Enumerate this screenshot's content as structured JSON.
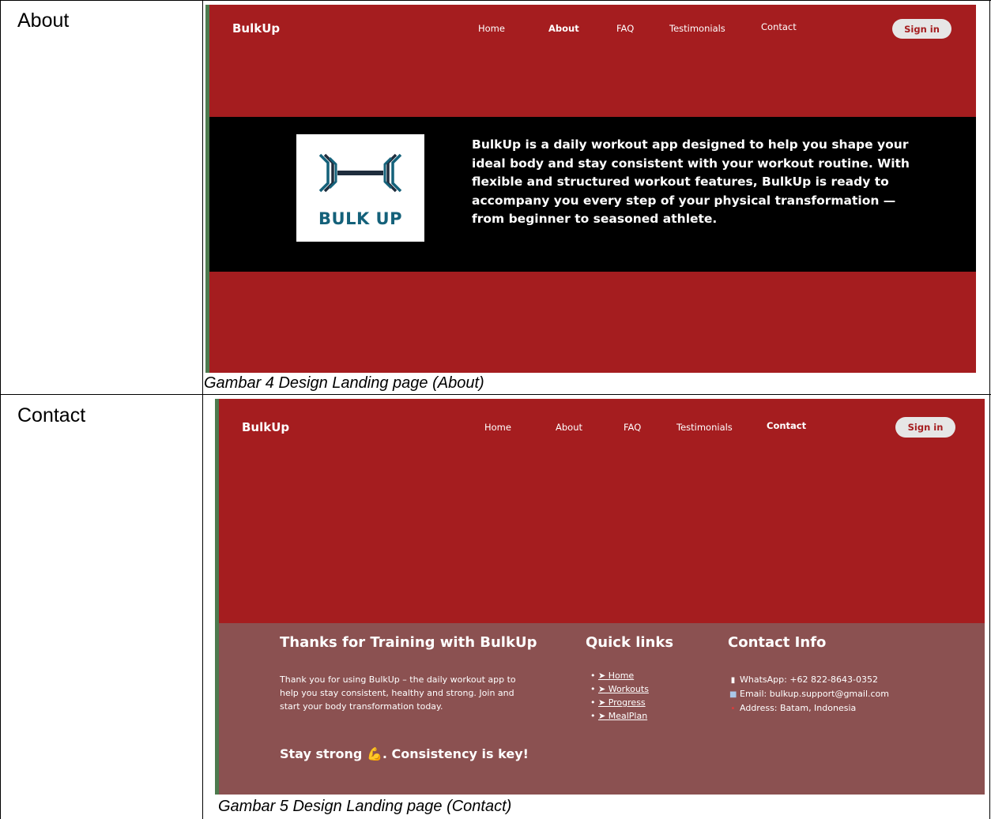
{
  "rows": [
    {
      "label": "About",
      "caption": "Gambar 4 Design Landing page (About)",
      "nav": {
        "brand": "BulkUp",
        "links": [
          "Home",
          "About",
          "FAQ",
          "Testimonials",
          "Contact"
        ],
        "active": "About",
        "signin": "Sign in"
      },
      "logo_text": "BULK UP",
      "about_text": "BulkUp is a daily workout app designed to help you shape your ideal body and stay consistent with your workout routine. With flexible and structured workout features, BulkUp is ready to accompany you every step of your physical transformation — from beginner to seasoned athlete."
    },
    {
      "label": "Contact",
      "caption": "Gambar 5 Design Landing page (Contact)",
      "nav": {
        "brand": "BulkUp",
        "links": [
          "Home",
          "About",
          "FAQ",
          "Testimonials",
          "Contact"
        ],
        "active": "Contact",
        "signin": "Sign in"
      },
      "footer": {
        "thanks_title": "Thanks for Training with BulkUp",
        "thanks_text": "Thank you for using BulkUp – the daily workout app to help you stay consistent, healthy and strong. Join and start your body transformation today.",
        "stay_strong": "Stay strong 💪. Consistency is key!",
        "quick_title": "Quick links",
        "quick_links": [
          "➤ Home",
          "➤ Workouts",
          "➤ Progress",
          "➤ MealPlan"
        ],
        "contact_title": "Contact Info",
        "contact_items": [
          {
            "icon": "phone-icon",
            "text": "WhatsApp: +62 822-8643-0352"
          },
          {
            "icon": "email-icon",
            "text": "Email: bulkup.support@gmail.com"
          },
          {
            "icon": "pin-icon",
            "text": "Address: Batam, Indonesia"
          }
        ]
      }
    }
  ],
  "colors": {
    "nav_red": "#a51d1f",
    "footer_brown": "#8b5151",
    "band_black": "#000000",
    "logo_teal": "#14617a",
    "signin_bg": "#e6e6e6"
  }
}
